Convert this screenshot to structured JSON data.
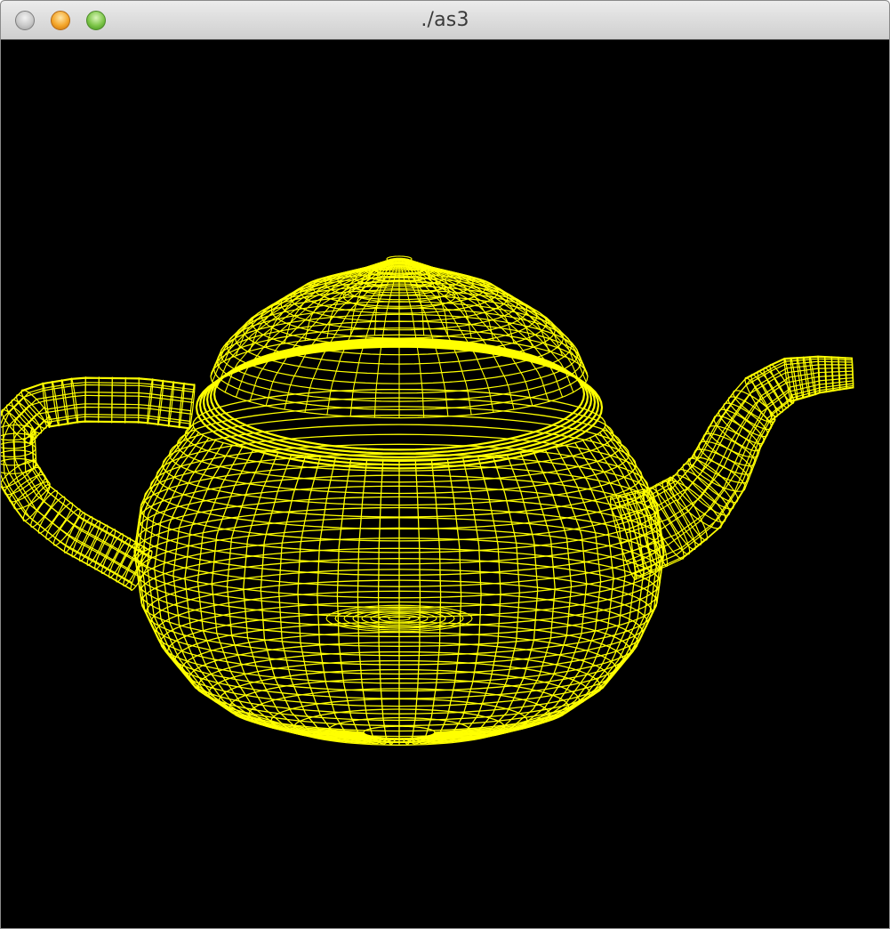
{
  "window": {
    "title": "./as3"
  },
  "titlebar": {
    "buttons": [
      "close-button",
      "minimize-button",
      "zoom-button"
    ]
  },
  "viewport": {
    "background": "#000000",
    "wire_color": "#ffff00",
    "model": "teapot",
    "render_mode": "wireframe"
  }
}
